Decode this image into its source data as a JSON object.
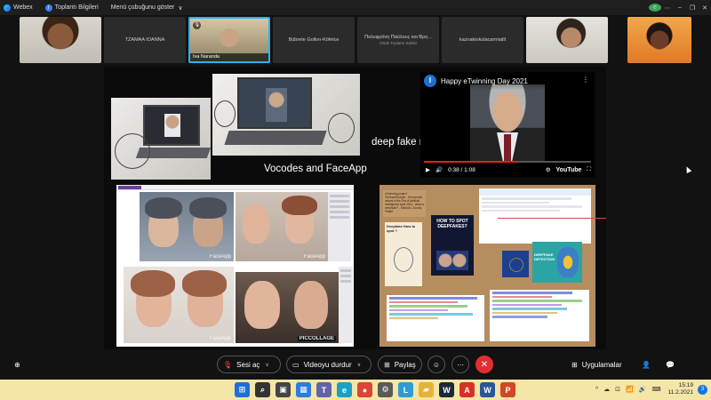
{
  "titlebar": {
    "app_name": "Webex",
    "meeting_info": "Toplantı Bilgileri",
    "menu_toggle": "Menü çubuğunu göster",
    "menu_caret": "∨",
    "user_initial": "e",
    "window_controls": [
      "⋯",
      "–",
      "❐",
      "✕"
    ]
  },
  "participants": [
    {
      "name": "",
      "photo": "woman-dark-hair"
    },
    {
      "name": "TZAMAA IOANNA",
      "sub": ""
    },
    {
      "name": "Iva Naranda",
      "photo": "man-in-room",
      "active": true
    },
    {
      "name": "Bübrete Gollon-Köfelce",
      "sub": ""
    },
    {
      "name": "Πολυφρόνη Παύλους και Βρη...",
      "sub": "Ortak Toplantı Sahibi"
    },
    {
      "name": "kaznakiokulacarmiallt",
      "sub": ""
    },
    {
      "name": "",
      "photo": "woman-white-room"
    },
    {
      "name": "",
      "photo": "woman-orange-bg"
    }
  ],
  "slide": {
    "caption_vocodes": "Vocodes and FaceApp",
    "caption_deepfake": "deep fake news",
    "youtube": {
      "channel_initial": "I",
      "title": "Happy eTwinning Day 2021",
      "time": "0:38 / 1:08",
      "progress_fraction": 0.56,
      "brand": "YouTube",
      "play_icon": "▶",
      "volume_icon": "🔊",
      "settings_icon": "⚙",
      "fullscreen_icon": "⛶",
      "menu_icon": "⋮"
    },
    "collage_watermarks": [
      "FaceApp",
      "FaceApp",
      "FaceApp",
      "PICCOLLAGE"
    ],
    "board": {
      "intro_text": "eTwinning project TechnoInEurope - Democratic values in the Era of Artificial Intelligence April 2021 - what is deepfake? - Edmodo, Zooms, Padlet",
      "poster_title": "HOW TO SPOT DEEPFAKES?",
      "sticky_title": "Deepfake How to spot ?",
      "teal_title": "DEEPFAKE DETECTION"
    }
  },
  "controls": {
    "mute_label": "Sesi aç",
    "video_label": "Videoyu durdur",
    "share_label": "Paylaş",
    "apps_label": "Uygulamalar",
    "end_icon": "✕",
    "more_icon": "⋯",
    "reaction_icon": "☺",
    "layout_icon": "⊕",
    "participants_icon": "👤",
    "chat_icon": "💬"
  },
  "taskbar": {
    "apps": [
      {
        "name": "start",
        "glyph": "⊞",
        "color": "#1e6fd9"
      },
      {
        "name": "search",
        "glyph": "⌕",
        "color": "#333333"
      },
      {
        "name": "task-view",
        "glyph": "▣",
        "color": "#444444"
      },
      {
        "name": "widgets",
        "glyph": "▦",
        "color": "#2b7de0"
      },
      {
        "name": "teams",
        "glyph": "T",
        "color": "#6264a7"
      },
      {
        "name": "edge",
        "glyph": "e",
        "color": "#1aa0c8"
      },
      {
        "name": "chrome",
        "glyph": "●",
        "color": "#db4437"
      },
      {
        "name": "settings",
        "glyph": "⚙",
        "color": "#5a5a5a"
      },
      {
        "name": "l-app",
        "glyph": "L",
        "color": "#2e9bd6"
      },
      {
        "name": "explorer",
        "glyph": "▰",
        "color": "#e8b23a"
      },
      {
        "name": "webex",
        "glyph": "W",
        "color": "#1b2a3a"
      },
      {
        "name": "acrobat",
        "glyph": "A",
        "color": "#d93025"
      },
      {
        "name": "word",
        "glyph": "W",
        "color": "#2b579a"
      },
      {
        "name": "powerpoint",
        "glyph": "P",
        "color": "#d24726"
      }
    ],
    "time": "15:19",
    "date": "11.2.2021",
    "notifications": "3",
    "tray": [
      "^",
      "☁",
      "⊡",
      "📶",
      "🔊",
      "⌨"
    ]
  },
  "colors": {
    "accent_active": "#2bb3f5",
    "end_red": "#e02f33",
    "taskbar": "#f3e6a6",
    "board": "#b58d5e"
  }
}
